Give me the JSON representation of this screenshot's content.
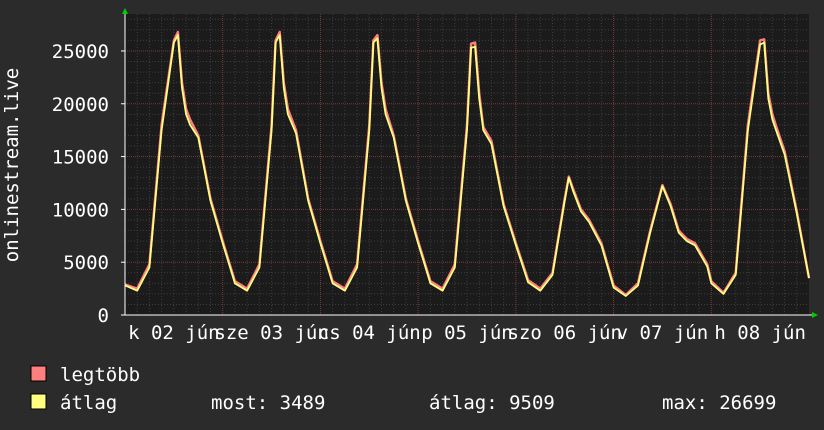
{
  "chart_data": {
    "type": "line",
    "ylabel": "onlinestream.live",
    "yticks": [
      0,
      5000,
      10000,
      15000,
      20000,
      25000
    ],
    "ylim": [
      0,
      28500
    ],
    "x_tick_labels": [
      "k 02 jún",
      "sze 03 jún",
      "cs 04 jún",
      "p 05 jún",
      "szo 06 jún",
      "v 07 jún",
      "h 08 jún"
    ],
    "x_range_hours": 168,
    "grid": true,
    "series": [
      {
        "name": "legtöbb",
        "color": "#ff7f7f",
        "x_hours": [
          0,
          3,
          6,
          9,
          12,
          13,
          14,
          15,
          16,
          18,
          21,
          24,
          27,
          30,
          33,
          36,
          37,
          38,
          39,
          40,
          42,
          45,
          48,
          51,
          54,
          57,
          60,
          61,
          62,
          63,
          64,
          66,
          69,
          72,
          75,
          78,
          81,
          84,
          85,
          86,
          87,
          88,
          90,
          93,
          96,
          99,
          102,
          105,
          108,
          109,
          110,
          111,
          112,
          114,
          117,
          120,
          123,
          126,
          129,
          132,
          134,
          136,
          138,
          140,
          143,
          144,
          147,
          150,
          153,
          156,
          157,
          158,
          159,
          160,
          162,
          165,
          168
        ],
        "values": [
          2900,
          2500,
          4800,
          18000,
          26000,
          26800,
          22000,
          19500,
          18500,
          17000,
          11000,
          7000,
          3200,
          2500,
          4800,
          18000,
          26000,
          26800,
          22000,
          19500,
          17500,
          11000,
          7000,
          3200,
          2500,
          4800,
          18000,
          26000,
          26500,
          22000,
          19500,
          17000,
          11000,
          7000,
          3200,
          2500,
          4800,
          18000,
          25700,
          25800,
          21000,
          17800,
          16500,
          10500,
          6800,
          3300,
          2500,
          4000,
          11000,
          13100,
          12000,
          11000,
          10000,
          9000,
          6800,
          2800,
          1900,
          3000,
          8000,
          12300,
          10500,
          8000,
          7200,
          6800,
          4800,
          3200,
          2100,
          4000,
          18000,
          26000,
          26100,
          21000,
          19000,
          17800,
          15500,
          9800,
          3500
        ]
      },
      {
        "name": "átlag",
        "color": "#ffff80",
        "x_hours": [
          0,
          3,
          6,
          9,
          12,
          13,
          14,
          15,
          16,
          18,
          21,
          24,
          27,
          30,
          33,
          36,
          37,
          38,
          39,
          40,
          42,
          45,
          48,
          51,
          54,
          57,
          60,
          61,
          62,
          63,
          64,
          66,
          69,
          72,
          75,
          78,
          81,
          84,
          85,
          86,
          87,
          88,
          90,
          93,
          96,
          99,
          102,
          105,
          108,
          109,
          110,
          111,
          112,
          114,
          117,
          120,
          123,
          126,
          129,
          132,
          134,
          136,
          138,
          140,
          143,
          144,
          147,
          150,
          153,
          156,
          157,
          158,
          159,
          160,
          162,
          165,
          168
        ],
        "values": [
          2800,
          2300,
          4500,
          17500,
          25800,
          26500,
          21500,
          19000,
          18000,
          16800,
          10800,
          6800,
          3000,
          2300,
          4500,
          17500,
          25800,
          26500,
          21500,
          19000,
          17200,
          10800,
          6800,
          3000,
          2300,
          4500,
          17500,
          25800,
          26200,
          21500,
          19000,
          16800,
          10800,
          6800,
          3000,
          2300,
          4500,
          17500,
          25300,
          25400,
          20500,
          17500,
          16200,
          10300,
          6600,
          3100,
          2300,
          3800,
          10800,
          13000,
          11800,
          10800,
          9800,
          8800,
          6600,
          2600,
          1800,
          2800,
          7800,
          12200,
          10300,
          7800,
          7000,
          6600,
          4600,
          3000,
          2000,
          3800,
          17500,
          25600,
          25800,
          20500,
          18500,
          17400,
          15200,
          9600,
          3489
        ]
      }
    ],
    "legend_placement": "bottom-left",
    "legend": [
      {
        "label": "legtöbb",
        "color": "#ff7f7f"
      },
      {
        "label": "átlag",
        "color": "#ffff80"
      }
    ],
    "stats": {
      "current": "most: 3489",
      "average": "átlag: 9509",
      "maximum": "max: 26699"
    }
  }
}
